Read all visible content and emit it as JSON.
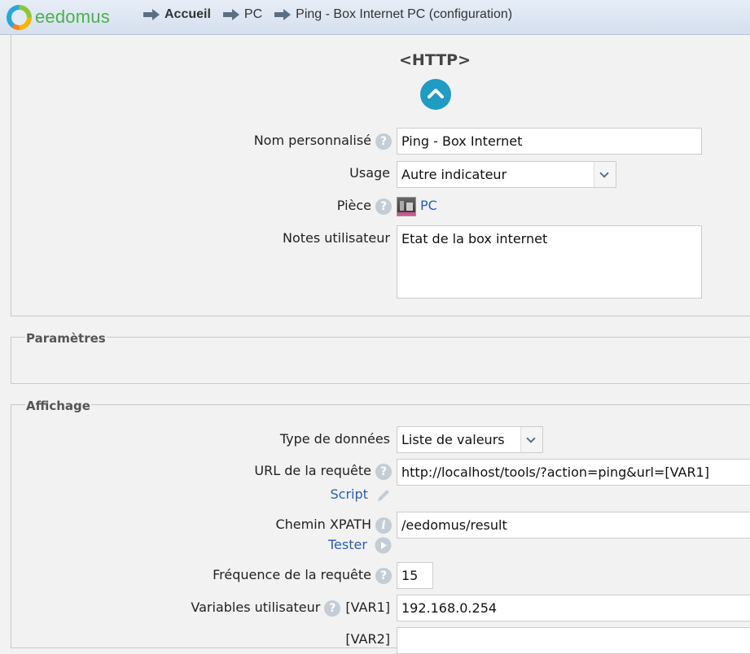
{
  "header": {
    "logo_text": "eedomus",
    "breadcrumb": [
      "Accueil",
      "PC",
      "Ping - Box Internet PC (configuration)"
    ]
  },
  "device": {
    "type": "<HTTP>",
    "name_label": "Nom personnalisé",
    "name_value": "Ping - Box Internet",
    "usage_label": "Usage",
    "usage_value": "Autre indicateur",
    "room_label": "Pièce",
    "room_value": "PC",
    "notes_label": "Notes utilisateur",
    "notes_value": "Etat de la box internet"
  },
  "sections": {
    "parameters": "Paramètres",
    "display": "Affichage"
  },
  "display": {
    "data_type_label": "Type de données",
    "data_type_value": "Liste de valeurs",
    "url_label": "URL de la requête",
    "url_value": "http://localhost/tools/?action=ping&url=[VAR1]",
    "script_link": "Script",
    "xpath_label": "Chemin XPATH",
    "xpath_value": "/eedomus/result",
    "test_link": "Tester",
    "frequency_label": "Fréquence de la requête",
    "frequency_value": "15",
    "uservars_label": "Variables utilisateur",
    "var1_label": "[VAR1]",
    "var1_value": "192.168.0.254",
    "var2_label": "[VAR2]",
    "var2_value": ""
  },
  "colors": {
    "accent": "#1f9bc4",
    "link": "#2a5db0",
    "brand": "#4caf50"
  }
}
